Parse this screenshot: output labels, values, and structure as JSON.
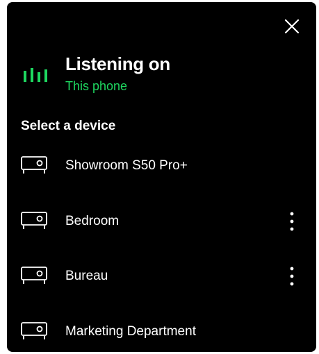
{
  "listening": {
    "title": "Listening on",
    "device": "This phone"
  },
  "section_title": "Select a device",
  "devices": [
    {
      "name": "Showroom S50 Pro+",
      "has_more": false
    },
    {
      "name": "Bedroom",
      "has_more": true
    },
    {
      "name": "Bureau",
      "has_more": true
    },
    {
      "name": "Marketing Department",
      "has_more": false
    }
  ],
  "icons": {
    "close": "close-icon",
    "equalizer": "equalizer-icon",
    "speaker": "speaker-icon",
    "more": "more-vertical-icon"
  },
  "colors": {
    "background": "#000000",
    "text": "#ffffff",
    "accent": "#1ed760"
  }
}
